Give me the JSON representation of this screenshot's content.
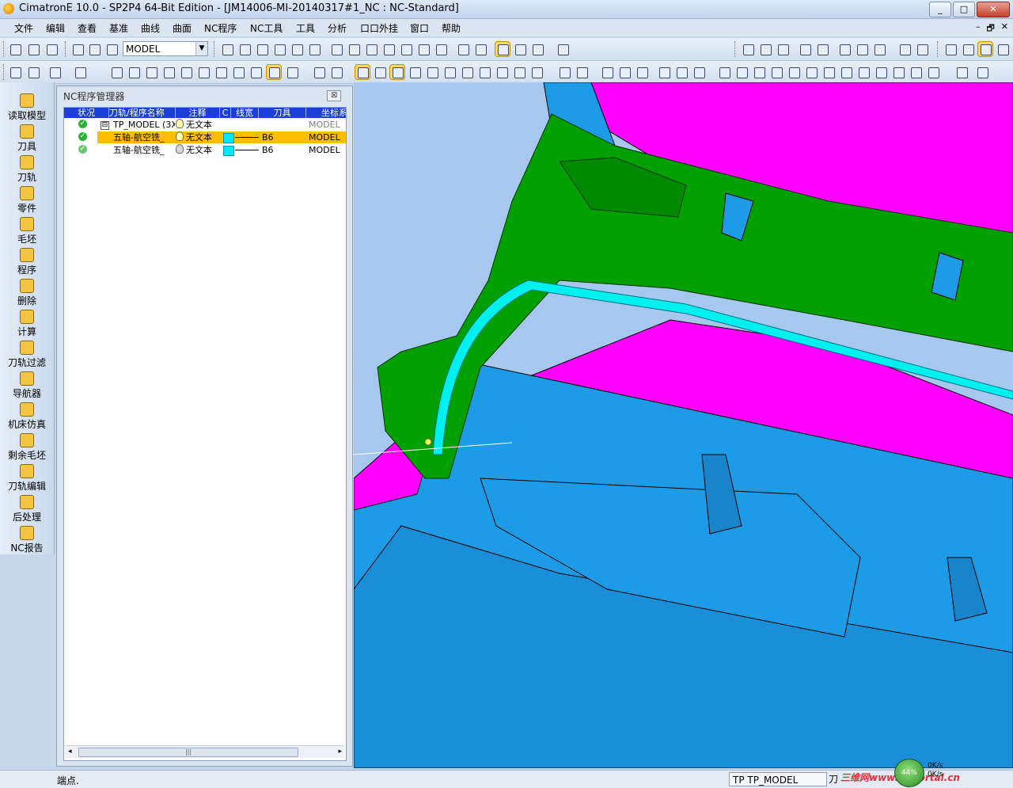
{
  "window": {
    "title": "CimatronE 10.0 - SP2P4 64-Bit Edition - [JM14006-MI-20140317#1_NC : NC-Standard]",
    "min": "_",
    "max": "□",
    "close": "✕"
  },
  "menu": [
    "文件",
    "编辑",
    "查看",
    "基准",
    "曲线",
    "曲面",
    "NC程序",
    "NC工具",
    "工具",
    "分析",
    "口口外挂",
    "窗口",
    "帮助"
  ],
  "mdi_controls": [
    "–",
    "🗗",
    "✕"
  ],
  "toolbar": {
    "model_combo": "MODEL"
  },
  "sidebar": [
    "读取模型",
    "刀具",
    "刀轨",
    "零件",
    "毛坯",
    "程序",
    "删除",
    "计算",
    "刀轨过滤",
    "导航器",
    "机床仿真",
    "剩余毛坯",
    "刀轨编辑",
    "后处理",
    "NC报告"
  ],
  "panel": {
    "title": "NC程序管理器",
    "close": "☒",
    "columns": [
      "状况",
      "刀轨/程序名称",
      "注释",
      "C",
      "线宽",
      "刀具",
      "坐标系"
    ],
    "rows": [
      {
        "tree": "⊟",
        "name": "TP_MODEL (3X",
        "comment": "无文本",
        "tool": "",
        "cs": "MODEL",
        "selected": false,
        "bulb": "on"
      },
      {
        "tree": "",
        "name": "五轴-航空铣_",
        "comment": "无文本",
        "tool": "B6",
        "cs": "MODEL",
        "selected": true,
        "bulb": "on"
      },
      {
        "tree": "",
        "name": "五轴-航空铣_",
        "comment": "无文本",
        "tool": "B6",
        "cs": "MODEL",
        "selected": false,
        "bulb": "off"
      }
    ],
    "scroll_thumb": "|||",
    "scroll_left": "◂",
    "scroll_right": "▸"
  },
  "status": {
    "left": "端点.",
    "tp": "TP  TP_MODEL",
    "last": "刀"
  },
  "watermark": "三维网www.3dportal.cn",
  "net": {
    "percent": "44%",
    "up": "0K/s",
    "down": "0K/s"
  },
  "colors": {
    "green": "#00a000",
    "magenta": "#ff00ff",
    "blue": "#1e9be6",
    "cyan": "#00f0f0",
    "highlight": "#ffbf00"
  },
  "icons": [
    "new-file-icon",
    "open-folder-icon",
    "save-icon",
    "zoom-icon",
    "pan-icon",
    "rotate-icon",
    "cube-icon",
    "shaded-icon",
    "wireframe-icon",
    "light-bulb-icon",
    "check-icon",
    "tree-collapse-icon"
  ]
}
